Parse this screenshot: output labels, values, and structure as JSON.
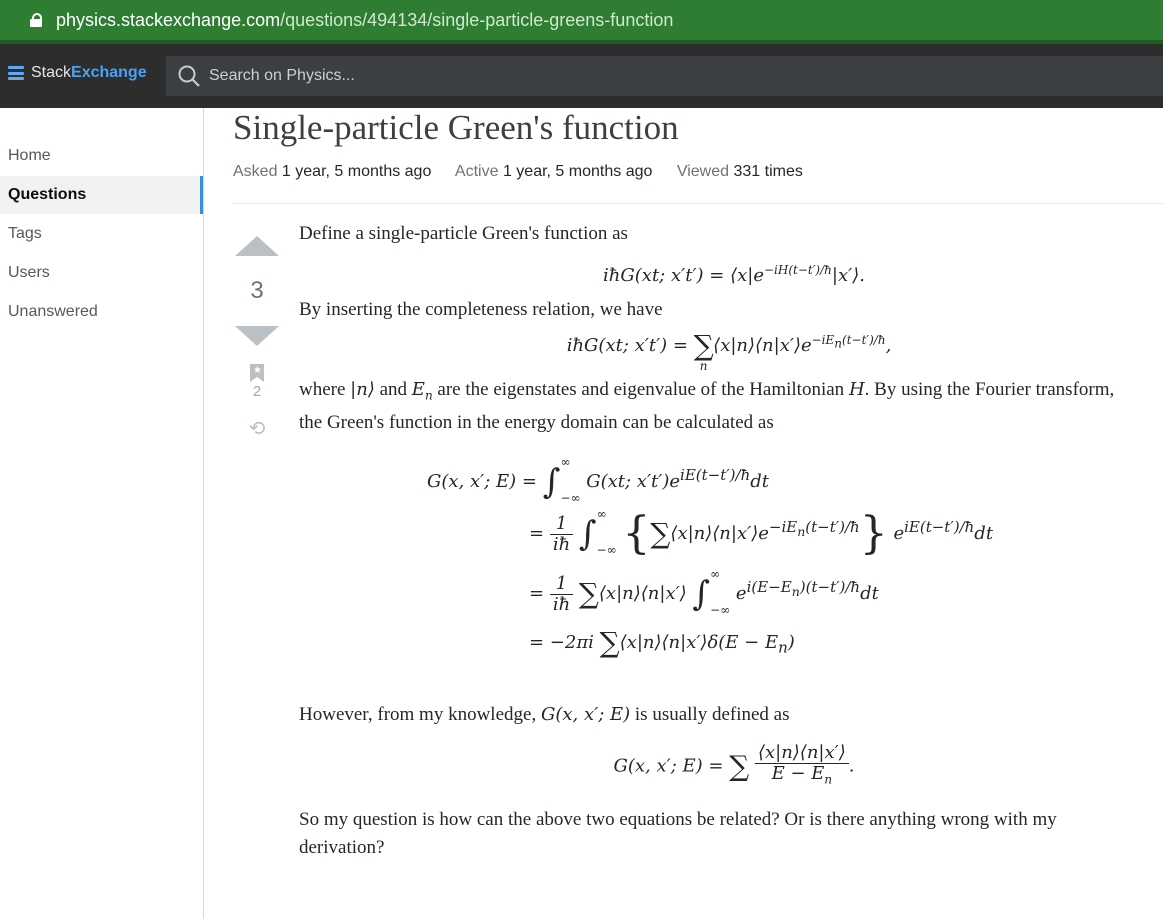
{
  "browser": {
    "url_host": "physics.stackexchange.com",
    "url_path": "/questions/494134/single-particle-greens-function"
  },
  "header": {
    "logo_stack": "Stack",
    "logo_exchange": "Exchange",
    "search_placeholder": "Search on Physics..."
  },
  "sidebar": {
    "items": [
      {
        "label": "Home"
      },
      {
        "label": "Questions"
      },
      {
        "label": "Tags"
      },
      {
        "label": "Users"
      },
      {
        "label": "Unanswered"
      }
    ]
  },
  "question": {
    "title": "Single-particle Green's function",
    "asked_label": "Asked",
    "asked_value": "1 year, 5 months ago",
    "active_label": "Active",
    "active_value": "1 year, 5 months ago",
    "viewed_label": "Viewed",
    "viewed_value": "331 times",
    "votes": "3",
    "bookmarks": "2",
    "p1": "Define a single-particle Green's function as",
    "p2": "By inserting the completeness relation, we have",
    "p3": "are the eigenstates and eigenvalue of the Hamiltonian",
    "p3b": "By using the Fourier transform, the Green's function in the energy domain can be calculated as",
    "p4": "However, from my knowledge,",
    "p4b": "is usually defined as",
    "p5": "So my question is how can the above two equations be related? Or is there anything wrong with my derivation?"
  },
  "colors": {
    "url_bar": "#2e7d32",
    "top_bar": "#2d2d2d",
    "accent": "#3a8fd9"
  }
}
